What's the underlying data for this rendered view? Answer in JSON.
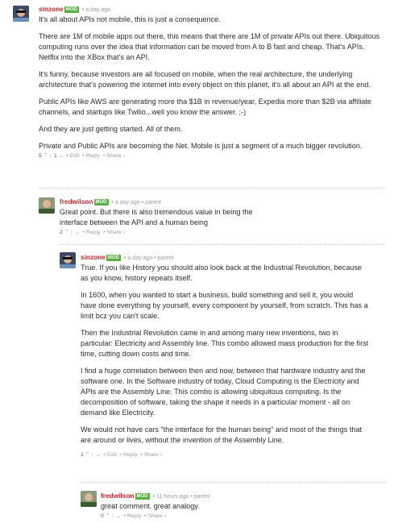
{
  "comments": [
    {
      "author": "sinzone",
      "mod_badge": "MOD",
      "time": "a day ago",
      "parent": "",
      "paragraphs": [
        "It's all about APIs not mobile, this is just a consequence.",
        "There are 1M of mobile apps out there, this means that there are 1M of private APIs out there. Ubiquitous computing runs over the idea that information can be moved from A to B fast and cheap. That's APIs. Netflix into the XBox that's an API.",
        "It's funny, because investors are all focused on mobile, when the real architecture, the underlying architecture that's powering the internet into every object on this planet, it's all about an API at the end.",
        "Public APIs like AWS are generating more tha $1B in revenue/year, Expedia more than $2B via affiliate channels, and startups like Twilio...well you know the answer. ;-)",
        "And they are just getting started. All of them.",
        "Private and Public APIs are becoming the Net. Mobile is just a segment of a much bigger revolution."
      ],
      "upvotes": "5",
      "downvotes": "1",
      "actions": [
        "Edit",
        "Reply",
        "Share ›"
      ]
    },
    {
      "author": "fredwilson",
      "mod_badge": "MOD",
      "time": "a day ago",
      "parent": "parent",
      "paragraphs": [
        "Great point. But there is also tremendous value in being the interface between the API and a human being"
      ],
      "upvotes": "2",
      "downvotes": "",
      "actions": [
        "Reply",
        "Share ›"
      ]
    },
    {
      "author": "sinzone",
      "mod_badge": "MOD",
      "time": "a day ago",
      "parent": "parent",
      "paragraphs": [
        "True. If you like History you should also look back at the Industrial Revolution, because as you know, history repeats itself.",
        "In 1600, when you wanted to start a business, build something and sell it, you would have done everything by yourself, every component by yourself, from scratch. This has a limit bcz you can't scale.",
        "Then the Industrial Revolution came in and among many new inventions, two in particular: Electricity and Assembly line. This combo allowed mass production for the first time, cutting down costs and time.",
        "I find a huge correlation between then and now, between that hardware industry and the software one. In the Software industry of today, Cloud Computing is the Electricity and APIs are the Assembly Line. This combo is allowing ubiquitous computing. Is the decomposition of software, taking the shape it needs in a particular moment - all on demand like Electricity.",
        "We would not have cars \"the interface for the human being\" and most of the things that are around or lives, without the invention of the Assembly Line."
      ],
      "upvotes": "1",
      "downvotes": "",
      "actions": [
        "Edit",
        "Reply",
        "Share ›"
      ]
    },
    {
      "author": "fredwilson",
      "mod_badge": "MOD",
      "time": "11 hours ago",
      "parent": "parent",
      "paragraphs": [
        "great comment. great analogy."
      ],
      "upvotes": "0",
      "downvotes": "",
      "actions": [
        "Reply",
        "Share ›"
      ]
    }
  ]
}
